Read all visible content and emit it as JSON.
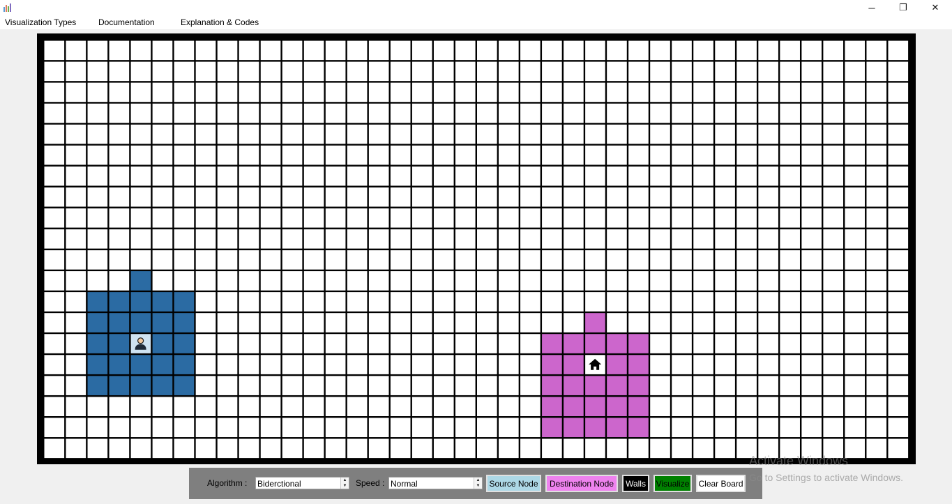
{
  "window": {
    "app_icon": "bar-chart-icon",
    "controls": {
      "minimize": "─",
      "maximize": "❐",
      "close": "✕"
    }
  },
  "menu": {
    "items": [
      {
        "label": "Visualization Types"
      },
      {
        "label": "Documentation"
      },
      {
        "label": "Explanation & Codes"
      }
    ]
  },
  "board": {
    "rows": 20,
    "cols": 40,
    "colors": {
      "empty": "#ffffff",
      "grid": "#000000",
      "source_visited": "#2b6ba3",
      "dest_visited": "#cc66cc"
    },
    "source": {
      "row": 14,
      "col": 4,
      "icon": "person-icon"
    },
    "destination": {
      "row": 15,
      "col": 25,
      "icon": "home-icon"
    },
    "visited_source": [
      [
        11,
        4
      ],
      [
        12,
        2
      ],
      [
        12,
        3
      ],
      [
        12,
        4
      ],
      [
        12,
        5
      ],
      [
        12,
        6
      ],
      [
        13,
        2
      ],
      [
        13,
        3
      ],
      [
        13,
        4
      ],
      [
        13,
        5
      ],
      [
        13,
        6
      ],
      [
        14,
        2
      ],
      [
        14,
        3
      ],
      [
        14,
        5
      ],
      [
        14,
        6
      ],
      [
        15,
        2
      ],
      [
        15,
        3
      ],
      [
        15,
        4
      ],
      [
        15,
        5
      ],
      [
        15,
        6
      ],
      [
        16,
        2
      ],
      [
        16,
        3
      ],
      [
        16,
        4
      ],
      [
        16,
        5
      ],
      [
        16,
        6
      ]
    ],
    "visited_dest": [
      [
        13,
        25
      ],
      [
        14,
        23
      ],
      [
        14,
        24
      ],
      [
        14,
        25
      ],
      [
        14,
        26
      ],
      [
        14,
        27
      ],
      [
        15,
        23
      ],
      [
        15,
        24
      ],
      [
        15,
        26
      ],
      [
        15,
        27
      ],
      [
        16,
        23
      ],
      [
        16,
        24
      ],
      [
        16,
        25
      ],
      [
        16,
        26
      ],
      [
        16,
        27
      ],
      [
        17,
        23
      ],
      [
        17,
        24
      ],
      [
        17,
        25
      ],
      [
        17,
        26
      ],
      [
        17,
        27
      ],
      [
        18,
        23
      ],
      [
        18,
        24
      ],
      [
        18,
        25
      ],
      [
        18,
        26
      ],
      [
        18,
        27
      ]
    ]
  },
  "toolbar": {
    "algorithm_label": "Algorithm :",
    "algorithm_value": "Biderctional",
    "speed_label": "Speed :",
    "speed_value": "Normal",
    "buttons": {
      "source_node": {
        "label": "Source Node",
        "bg": "#add8e6",
        "fg": "#000000"
      },
      "destination_node": {
        "label": "Destination Node",
        "bg": "#ee82ee",
        "fg": "#000000"
      },
      "walls": {
        "label": "Walls",
        "bg": "#000000",
        "fg": "#ffffff"
      },
      "visualize": {
        "label": "Visualize",
        "bg": "#008000",
        "fg": "#000000"
      },
      "clear_board": {
        "label": "Clear Board",
        "bg": "#ffffff",
        "fg": "#000000"
      }
    }
  },
  "watermark": {
    "line1": "Activate Windows",
    "line2": "Go to Settings to activate Windows."
  }
}
